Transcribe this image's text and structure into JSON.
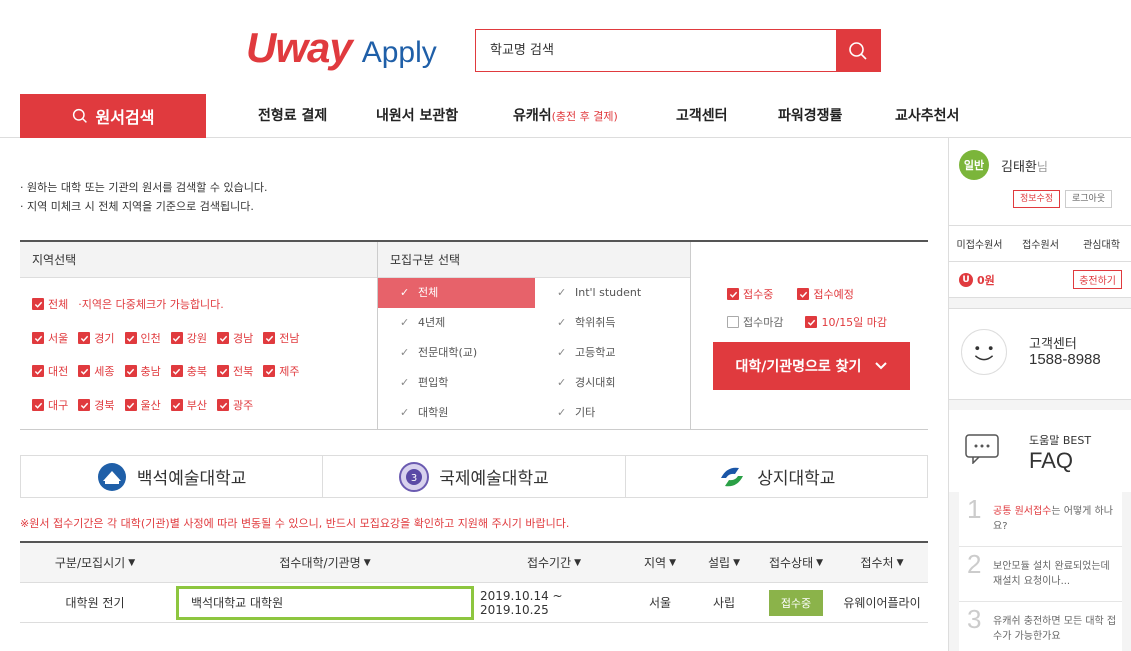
{
  "header": {
    "logo_uway": "Uway",
    "logo_apply": "Apply",
    "search_placeholder": "학교명 검색"
  },
  "nav": {
    "search_label": "원서검색",
    "items": [
      "전형료 결제",
      "내원서 보관함",
      "유캐쉬",
      "고객센터",
      "파워경쟁률",
      "교사추천서"
    ],
    "ucash_note": "(충전 후 결제)"
  },
  "info": {
    "line1": "· 원하는 대학 또는 기관의 원서를 검색할 수 있습니다.",
    "line2": "· 지역 미체크 시 전체 지역을 기준으로 검색됩니다."
  },
  "filter": {
    "region_title": "지역선택",
    "region_all": "전체",
    "region_hint": "·지역은 다중체크가 가능합니다.",
    "regions_row1": [
      "서울",
      "경기",
      "인천",
      "강원",
      "경남",
      "전남"
    ],
    "regions_row2": [
      "대전",
      "세종",
      "충남",
      "충북",
      "전북",
      "제주"
    ],
    "regions_row3": [
      "대구",
      "경북",
      "울산",
      "부산",
      "광주"
    ],
    "type_title": "모집구분 선택",
    "types_left": [
      "전체",
      "4년제",
      "전문대학(교)",
      "편입학",
      "대학원"
    ],
    "types_right": [
      "Int'l student",
      "학위취득",
      "고등학교",
      "경시대회",
      "기타"
    ],
    "status": [
      {
        "label": "접수중",
        "checked": true
      },
      {
        "label": "접수예정",
        "checked": true
      },
      {
        "label": "접수마감",
        "checked": false
      },
      {
        "label": "10/15일 마감",
        "checked": true
      }
    ],
    "find_button": "대학/기관명으로 찾기"
  },
  "universities": [
    "백석예술대학교",
    "국제예술대학교",
    "상지대학교"
  ],
  "notice": "※원서 접수기간은 각 대학(기관)별 사정에 따라 변동될 수 있으니, 반드시 모집요강을 확인하고 지원해 주시기 바랍니다.",
  "table": {
    "headers": [
      "구분/모집시기",
      "접수대학/기관명",
      "접수기간",
      "지역",
      "설립",
      "접수상태",
      "접수처"
    ],
    "row": {
      "type": "대학원 전기",
      "name": "백석대학교 대학원",
      "period": "2019.10.14 ~ 2019.10.25",
      "region": "서울",
      "founding": "사립",
      "status": "접수중",
      "agency": "유웨이어플라이"
    }
  },
  "sidebar": {
    "badge": "일반",
    "user_name": "김태환",
    "honorific": "님",
    "edit_info": "정보수정",
    "logout": "로그아웃",
    "tabs": [
      "미접수원서",
      "접수원서",
      "관심대학"
    ],
    "balance": "0원",
    "charge": "충전하기",
    "cs_title": "고객센터",
    "cs_phone": "1588-8988",
    "faq_sub": "도움말 BEST",
    "faq_title": "FAQ",
    "faq_items": [
      {
        "num": "1",
        "hl": "공통 원서접수",
        "rest": "는 어떻게 하나요?"
      },
      {
        "num": "2",
        "hl": "",
        "rest": "보안모듈 설치 완료되었는데 재설치 요청이나..."
      },
      {
        "num": "3",
        "hl": "",
        "rest": "유캐쉬 충전하면 모든 대학 접수가 가능한가요"
      }
    ]
  },
  "colors": {
    "accent": "#e03a3e",
    "highlight": "#8dc63f",
    "status_green": "#8bb34a"
  }
}
